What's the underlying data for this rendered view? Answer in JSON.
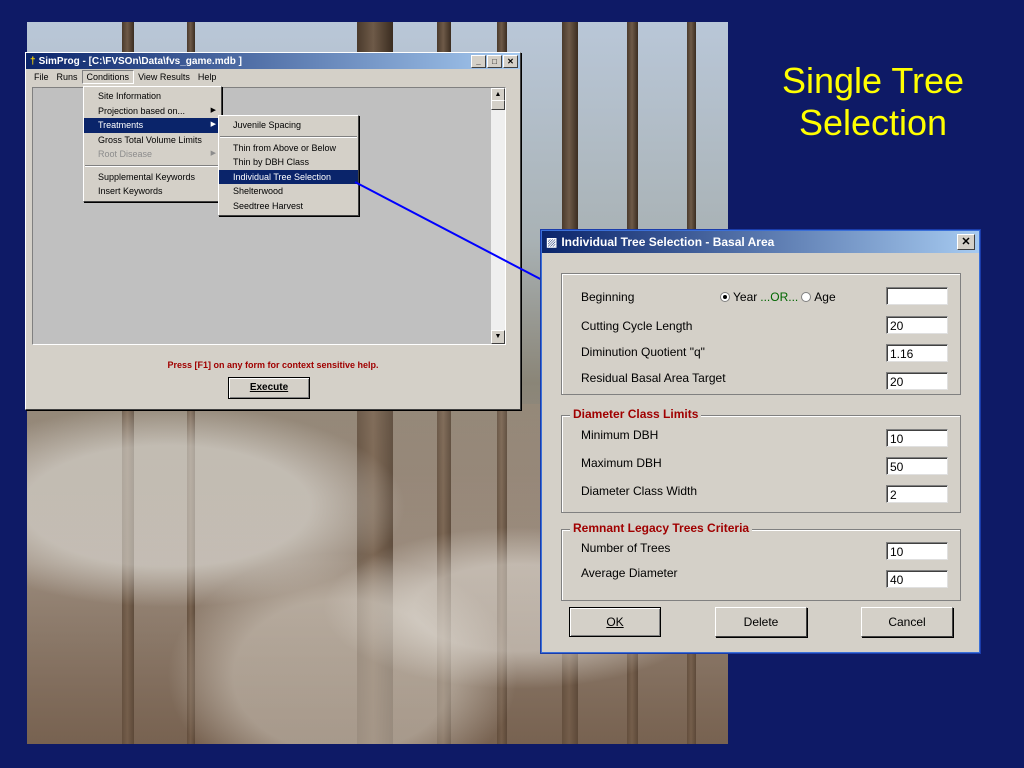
{
  "slide": {
    "title_line1": "Single Tree",
    "title_line2": "Selection"
  },
  "simprog": {
    "title": "SimProg - [C:\\FVSOn\\Data\\fvs_game.mdb ]",
    "menu": [
      "File",
      "Runs",
      "Conditions",
      "View Results",
      "Help"
    ],
    "help_text": "Press [F1] on any form for context sensitive help.",
    "execute_label": "Execute"
  },
  "conditions_menu": [
    {
      "label": "Site Information"
    },
    {
      "label": "Projection based on...",
      "submenu": true
    },
    {
      "label": "Treatments",
      "submenu": true,
      "selected": true
    },
    {
      "label": "Gross Total Volume Limits"
    },
    {
      "label": "Root Disease",
      "submenu": true,
      "disabled": true
    },
    {
      "label": "Supplemental Keywords"
    },
    {
      "label": "Insert Keywords"
    }
  ],
  "treatments_menu": [
    {
      "label": "Juvenile Spacing"
    },
    {
      "label": "Thin from Above or Below"
    },
    {
      "label": "Thin by DBH Class"
    },
    {
      "label": "Individual Tree Selection",
      "selected": true
    },
    {
      "label": "Shelterwood"
    },
    {
      "label": "Seedtree Harvest"
    }
  ],
  "dialog": {
    "title": "Individual Tree Selection - Basal Area",
    "beginning_label": "Beginning",
    "year_label": "Year",
    "or_label": "...OR...",
    "age_label": "Age",
    "beginning_value": "",
    "cutting_cycle_label": "Cutting Cycle Length",
    "cutting_cycle_value": "20",
    "diminution_label": "Diminution Quotient \"q\"",
    "diminution_value": "1.16",
    "residual_label": "Residual Basal Area Target",
    "residual_value": "20",
    "diameter_group": "Diameter Class Limits",
    "min_dbh_label": "Minimum DBH",
    "min_dbh_value": "10",
    "max_dbh_label": "Maximum DBH",
    "max_dbh_value": "50",
    "class_width_label": "Diameter Class Width",
    "class_width_value": "2",
    "remnant_group": "Remnant Legacy Trees Criteria",
    "num_trees_label": "Number of Trees",
    "num_trees_value": "10",
    "avg_diameter_label": "Average Diameter",
    "avg_diameter_value": "40",
    "ok_label": "OK",
    "delete_label": "Delete",
    "cancel_label": "Cancel"
  },
  "colors": {
    "background": "#0e1a66",
    "title": "#ffff00",
    "group_title": "#a00000",
    "pointer_line": "#0000ff"
  }
}
